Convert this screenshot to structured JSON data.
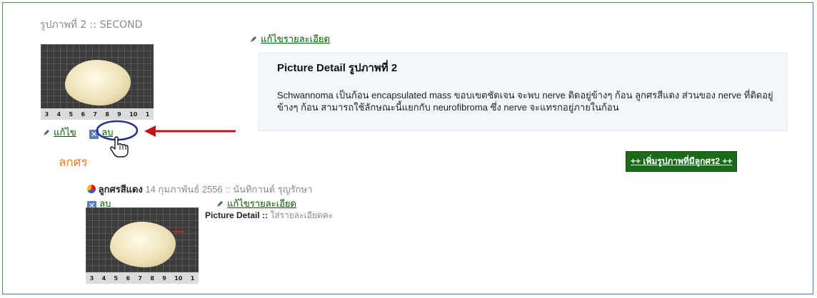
{
  "header": {
    "picture_title": "รูปภาพที่ 2 :: SECOND"
  },
  "main_picture": {
    "edit_label": "แก้ไข",
    "delete_label": "ลบ",
    "ruler_numbers": [
      "3",
      "4",
      "5",
      "6",
      "7",
      "8",
      "9",
      "10",
      "1"
    ]
  },
  "detail": {
    "edit_detail_label": "แก้ไขรายละเอียด",
    "box_title": "Picture Detail รูปภาพที่ 2",
    "box_text": "Schwannoma เป็นก้อน encapsulated mass ขอบเขตชัดเจน จะพบ nerve ติดอยู่ข้างๆ ก้อน ลูกศรสีแดง ส่วนของ nerve ที่ติดอยู่ข้างๆ ก้อน สามารถใช้ลักษณะนี้แยกกับ neurofibroma ซึ่ง nerve จะแทรกอยู่ภายในก้อน"
  },
  "arrow_section": {
    "heading": "ลกศร",
    "add_button_label": "++ เพิ่มรูปภาพที่มีลูกศร2 ++"
  },
  "arrow_entry": {
    "name": "ลูกศรสีแดง",
    "meta": "14 กุมภาพันธ์ 2556 :: นันทิกานต์ รุญรักษา",
    "delete_label": "ลบ",
    "edit_detail_label": "แก้ไขรายละเอียด",
    "detail_label": "Picture Detail ::",
    "detail_text": "ใส่รายละเอียดคะ",
    "ruler_numbers": [
      "3",
      "4",
      "5",
      "6",
      "7",
      "8",
      "9",
      "10",
      "1"
    ]
  },
  "annotation": {
    "arrow_color": "#c0121a",
    "ring_color": "#23318c"
  },
  "colors": {
    "link_green": "#005a00",
    "heading_orange": "#f07d28",
    "frame_blue": "#4d7bb5"
  }
}
